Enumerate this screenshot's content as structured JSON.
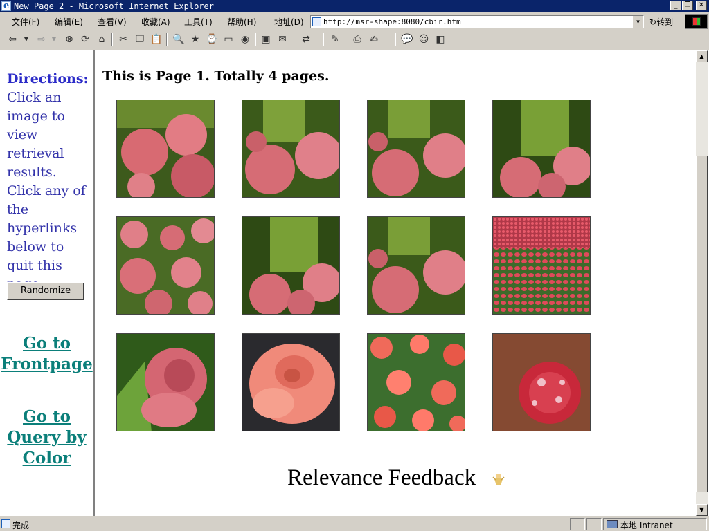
{
  "window": {
    "title": "New Page 2 - Microsoft Internet Explorer"
  },
  "menu": [
    {
      "label": "文件(F)"
    },
    {
      "label": "编辑(E)"
    },
    {
      "label": "查看(V)"
    },
    {
      "label": "收藏(A)"
    },
    {
      "label": "工具(T)"
    },
    {
      "label": "帮助(H)"
    }
  ],
  "address": {
    "label": "地址(D)",
    "url": "http://msr-shape:8080/cbir.htm",
    "go_label": "转到"
  },
  "toolbar_icons": [
    "back-icon",
    "forward-icon",
    "stop-icon",
    "refresh-icon",
    "home-icon",
    "cut-icon",
    "copy-icon",
    "paste-icon",
    "search-icon",
    "favorites-icon",
    "history-icon",
    "mail-icon",
    "print-icon",
    "edit-icon",
    "discuss-icon",
    "messenger-icon"
  ],
  "sidebar": {
    "directions_heading": "Directions:",
    "directions_text": "Click an image to view retrieval results. Click any of the hyperlinks below to quit this page.",
    "randomize_label": "Randomize",
    "link_frontpage": "Go to Frontpage",
    "link_query_color": "Go to Query by Color"
  },
  "main": {
    "page_heading": "This is Page 1. Totally 4 pages.",
    "relevance_feedback": "Relevance Feedback",
    "images": [
      {
        "kind": "pink-hydrangea"
      },
      {
        "kind": "pink-hydrangea"
      },
      {
        "kind": "pink-hydrangea"
      },
      {
        "kind": "pink-hydrangea"
      },
      {
        "kind": "pink-hydrangea"
      },
      {
        "kind": "pink-hydrangea"
      },
      {
        "kind": "pink-hydrangea"
      },
      {
        "kind": "tulip-field"
      },
      {
        "kind": "pink-rose"
      },
      {
        "kind": "peach-rose"
      },
      {
        "kind": "red-impatiens"
      },
      {
        "kind": "red-bloom"
      }
    ]
  },
  "status": {
    "text": "完成",
    "zone": "本地 Intranet"
  }
}
